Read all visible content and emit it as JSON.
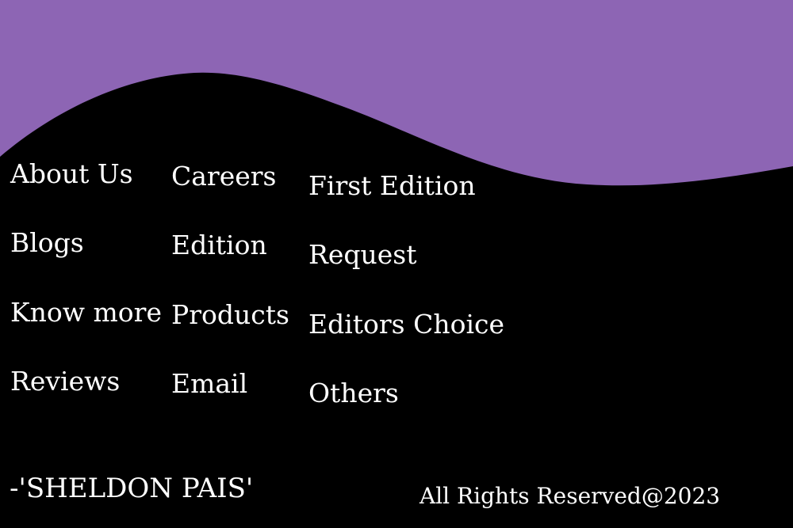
{
  "colors": {
    "background": "#000000",
    "wave": "#8d65b4",
    "text": "#ffffff"
  },
  "footer": {
    "columns": [
      {
        "links": [
          "About Us",
          "Blogs",
          "Know more",
          "Reviews"
        ]
      },
      {
        "links": [
          "Careers",
          "Edition",
          "Products",
          "Email"
        ]
      },
      {
        "links": [
          "First Edition",
          "Request",
          "Editors Choice",
          "Others"
        ]
      }
    ],
    "signature": "-'SHELDON PAIS'",
    "copyright": "All Rights Reserved@2023"
  }
}
